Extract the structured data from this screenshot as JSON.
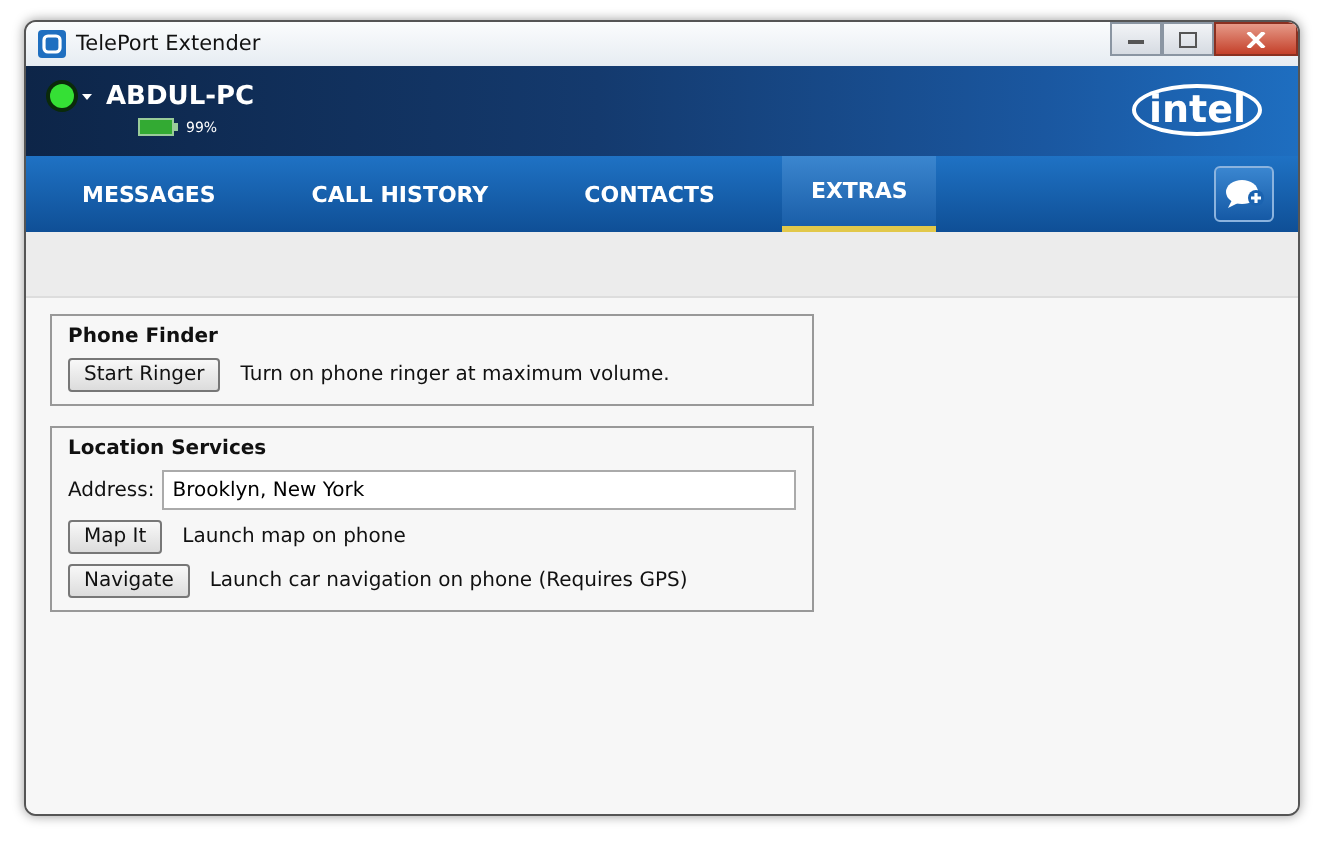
{
  "window": {
    "title": "TelePort Extender"
  },
  "device": {
    "name": "ABDUL-PC",
    "battery": "99%"
  },
  "logo": "intel",
  "tabs": [
    {
      "label": "MESSAGES",
      "selected": false
    },
    {
      "label": "CALL HISTORY",
      "selected": false
    },
    {
      "label": "CONTACTS",
      "selected": false
    },
    {
      "label": "EXTRAS",
      "selected": true
    }
  ],
  "groups": [
    {
      "title": "Phone Finder",
      "rows": [
        {
          "kind": "action",
          "button": "Start Ringer",
          "description": "Turn on phone ringer at maximum volume."
        }
      ]
    },
    {
      "title": "Location Services",
      "rows": [
        {
          "kind": "field",
          "label": "Address:",
          "value": "Brooklyn, New York"
        },
        {
          "kind": "action",
          "button": "Map It",
          "description": "Launch map on phone"
        },
        {
          "kind": "action",
          "button": "Navigate",
          "description": "Launch car navigation on phone (Requires GPS)"
        }
      ]
    }
  ]
}
